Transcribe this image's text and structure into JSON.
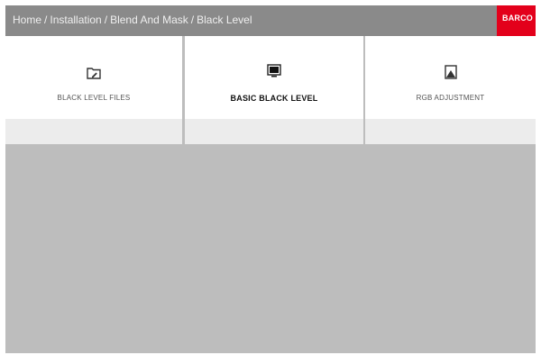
{
  "breadcrumb": {
    "items": [
      "Home",
      "Installation",
      "Blend And Mask",
      "Black Level"
    ],
    "separator": "/"
  },
  "brand": {
    "text": "BARCO",
    "color": "#e3001b"
  },
  "tabs": [
    {
      "label": "BLACK LEVEL FILES",
      "icon": "folder-edit-icon",
      "active": false
    },
    {
      "label": "BASIC BLACK LEVEL",
      "icon": "monitor-black-icon",
      "active": true
    },
    {
      "label": "RGB ADJUSTMENT",
      "icon": "image-adjust-icon",
      "active": false
    }
  ],
  "colors": {
    "header_bg": "#8a8a8a",
    "content_bg": "#bdbdbd",
    "tab_bg": "#ffffff",
    "tab_strip": "#ececec",
    "active_border": "#222222"
  }
}
